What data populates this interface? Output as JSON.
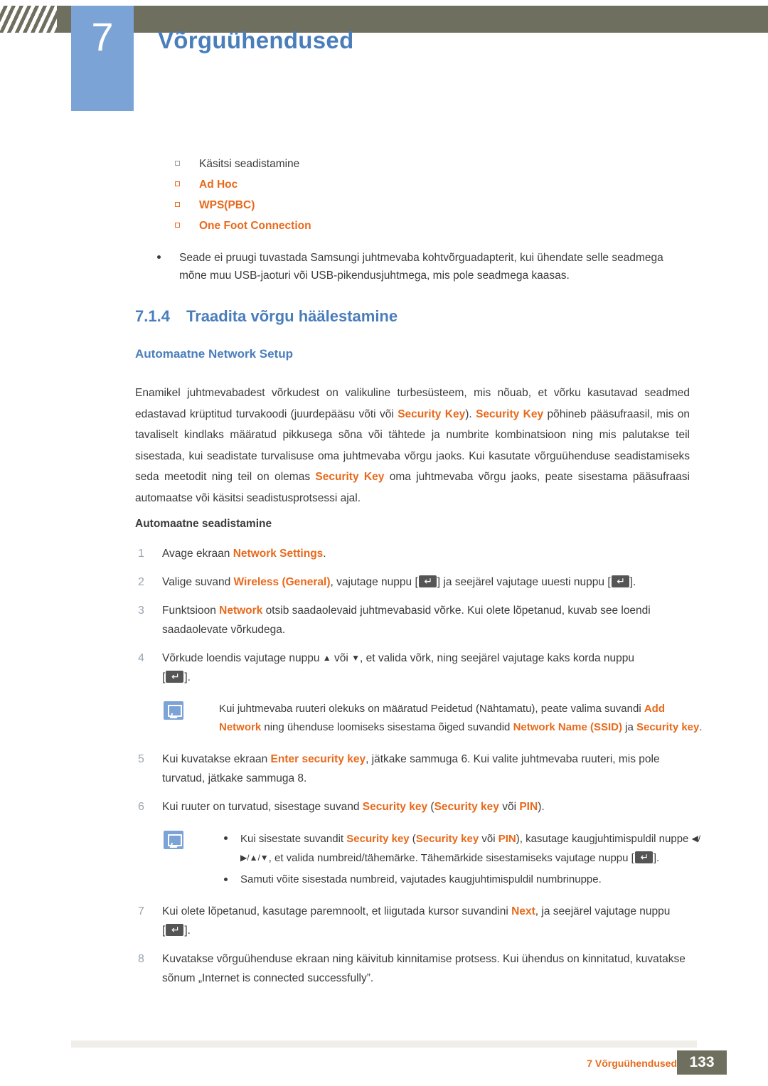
{
  "header": {
    "chapter_number": "7",
    "chapter_title": "Võrguühendused"
  },
  "square_bullets": [
    {
      "label": "Käsitsi seadistamine",
      "highlight": false
    },
    {
      "label": "Ad Hoc",
      "highlight": true
    },
    {
      "label": "WPS(PBC)",
      "highlight": true
    },
    {
      "label": "One Foot Connection",
      "highlight": true
    }
  ],
  "note_bullet": "Seade ei pruugi tuvastada Samsungi juhtmevaba kohtvõrguadapterit, kui ühendate selle seadmega mõne muu USB-jaoturi või USB-pikendusjuhtmega, mis pole seadmega kaasas.",
  "section": {
    "number": "7.1.4",
    "title": "Traadita võrgu häälestamine",
    "subtitle": "Automaatne Network Setup"
  },
  "paragraph": {
    "p1": "Enamikel juhtmevabadest võrkudest on valikuline turbesüsteem, mis nõuab, et võrku kasutavad seadmed edastavad krüptitud turvakoodi (juurdepääsu võti või ",
    "sk1": "Security Key",
    "p2": "). ",
    "sk2": "Security Key",
    "p3": " põhineb pääsufraasil, mis on tavaliselt kindlaks määratud pikkusega sõna või tähtede ja numbrite kombinatsioon ning mis palutakse teil sisestada, kui seadistate turvalisuse oma juhtmevaba võrgu jaoks. Kui kasutate võrguühenduse seadistamiseks seda meetodit ning teil on olemas ",
    "sk3": "Security Key",
    "p4": " oma juhtmevaba võrgu jaoks, peate sisestama pääsufraasi automaatse või käsitsi seadistusprotsessi ajal."
  },
  "auto_setup_heading": "Automaatne seadistamine",
  "steps": {
    "s1_n": "1",
    "s1_a": "Avage ekraan ",
    "s1_b": "Network Settings",
    "s1_c": ".",
    "s2_n": "2",
    "s2_a": "Valige suvand ",
    "s2_b": "Wireless (General)",
    "s2_c": ", vajutage nuppu ",
    "s2_d": " ja seejärel vajutage uuesti nuppu ",
    "s2_e": ".",
    "s3_n": "3",
    "s3_a": "Funktsioon ",
    "s3_b": "Network",
    "s3_c": " otsib saadaolevaid juhtmevabasid võrke. Kui olete lõpetanud, kuvab see loendi saadaolevate võrkudega.",
    "s4_n": "4",
    "s4_a": "Võrkude loendis vajutage nuppu ",
    "s4_up": "▲",
    "s4_b": " või ",
    "s4_dn": "▼",
    "s4_c": ", et valida võrk, ning seejärel vajutage kaks korda nuppu ",
    "s4_d": "[",
    "s4_e": "].",
    "s5_n": "5",
    "s5_a": "Kui kuvatakse ekraan ",
    "s5_b": "Enter security key",
    "s5_c": ", jätkake sammuga 6. Kui valite juhtmevaba ruuteri, mis pole turvatud, jätkake sammuga 8.",
    "s6_n": "6",
    "s6_a": "Kui ruuter on turvatud, sisestage suvand ",
    "s6_b": "Security key",
    "s6_c": " (",
    "s6_d": "Security key",
    "s6_e": " või ",
    "s6_f": "PIN",
    "s6_g": ").",
    "s7_n": "7",
    "s7_a": "Kui olete lõpetanud, kasutage paremnoolt, et liigutada kursor suvandini ",
    "s7_b": "Next",
    "s7_c": ", ja seejärel vajutage nuppu ",
    "s7_d": ".",
    "s8_n": "8",
    "s8_a": "Kuvatakse võrguühenduse ekraan ning käivitub kinnitamise protsess. Kui ühendus on kinnitatud, kuvatakse sõnum „Internet is connected successfully”."
  },
  "note1": {
    "a": "Kui juhtmevaba ruuteri olekuks on määratud Peidetud (Nähtamatu), peate valima suvandi ",
    "b": "Add Network",
    "c": " ning ühenduse loomiseks sisestama õiged suvandid ",
    "d": "Network Name (SSID)",
    "e": " ja ",
    "f": "Security key",
    "g": "."
  },
  "note2": {
    "l1_a": "Kui sisestate suvandit ",
    "l1_b": "Security key",
    "l1_c": " (",
    "l1_d": "Security key",
    "l1_e": " või ",
    "l1_f": "PIN",
    "l1_g": "), kasutage kaugjuhtimispuldil nuppe ",
    "l1_keys": "◀/▶/▲/▼",
    "l1_h": ", et valida numbreid/tähemärke. Tähemärkide sisestamiseks vajutage nuppu ",
    "l1_i": ".",
    "l2": "Samuti võite sisestada numbreid, vajutades kaugjuhtimispuldil numbrinuppe."
  },
  "footer": {
    "text": "7 Võrguühendused",
    "page": "133"
  },
  "colors": {
    "accent_blue": "#4a7ebb",
    "accent_orange": "#e8691b",
    "header_bar": "#6f6f5f",
    "chapter_box": "#7ba3d6"
  }
}
